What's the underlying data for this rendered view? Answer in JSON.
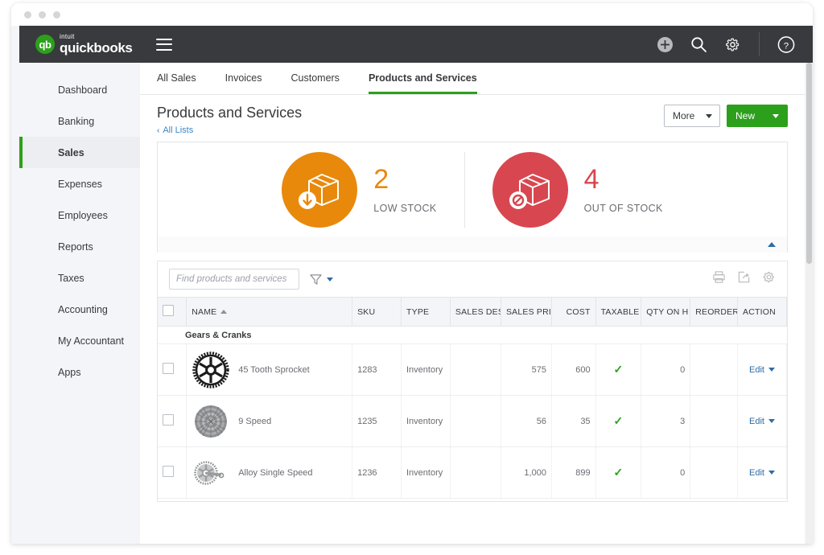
{
  "window": {
    "dots": [
      "dot-1",
      "dot-2",
      "dot-3"
    ]
  },
  "topbar": {
    "logo_intuit": "intuit",
    "logo_mark": "qb",
    "logo_name": "quickbooks",
    "menu_icon": "hamburger-menu-icon",
    "icons": [
      "add-circle-icon",
      "search-icon",
      "gear-icon",
      "help-circle-icon"
    ]
  },
  "sidebar": {
    "items": [
      {
        "label": "Dashboard",
        "active": false
      },
      {
        "label": "Banking",
        "active": false
      },
      {
        "label": "Sales",
        "active": true
      },
      {
        "label": "Expenses",
        "active": false
      },
      {
        "label": "Employees",
        "active": false
      },
      {
        "label": "Reports",
        "active": false
      },
      {
        "label": "Taxes",
        "active": false
      },
      {
        "label": "Accounting",
        "active": false
      },
      {
        "label": "My Accountant",
        "active": false
      },
      {
        "label": "Apps",
        "active": false
      }
    ]
  },
  "tabs": [
    {
      "label": "All Sales",
      "active": false
    },
    {
      "label": "Invoices",
      "active": false
    },
    {
      "label": "Customers",
      "active": false
    },
    {
      "label": "Products and Services",
      "active": true
    }
  ],
  "page": {
    "title": "Products and Services",
    "breadcrumb_chevron": "‹",
    "breadcrumb": "All Lists"
  },
  "actions": {
    "more_label": "More",
    "new_label": "New"
  },
  "stats": [
    {
      "value": "2",
      "label": "LOW STOCK",
      "color": "#e8890c",
      "icon": "box-down-arrow-icon"
    },
    {
      "value": "4",
      "label": "OUT OF STOCK",
      "color": "#d8474f",
      "icon": "box-prohibited-icon"
    }
  ],
  "collapse": {
    "icon": "chevron-up-icon"
  },
  "table_toolbar": {
    "search_placeholder": "Find products and services",
    "search_value": "",
    "filter_icon": "funnel-filter-icon",
    "print_icon": "printer-icon",
    "export_icon": "export-icon",
    "settings_icon": "gear-icon"
  },
  "table": {
    "columns": [
      {
        "key": "check",
        "label": ""
      },
      {
        "key": "name",
        "label": "NAME"
      },
      {
        "key": "sku",
        "label": "SKU"
      },
      {
        "key": "type",
        "label": "TYPE"
      },
      {
        "key": "sales_desc",
        "label": "SALES DES"
      },
      {
        "key": "sales_price",
        "label": "SALES PRIC"
      },
      {
        "key": "cost",
        "label": "COST"
      },
      {
        "key": "taxable",
        "label": "TAXABLE"
      },
      {
        "key": "qty_on_hand",
        "label": "QTY ON H"
      },
      {
        "key": "reorder",
        "label": "REORDER"
      },
      {
        "key": "action",
        "label": "ACTION"
      }
    ],
    "sort_column": "NAME",
    "sort_direction": "asc",
    "group_label": "Gears & Cranks",
    "action_label": "Edit",
    "taxable_mark": "✓",
    "rows": [
      {
        "name": "45 Tooth Sprocket",
        "sku": "1283",
        "type": "Inventory",
        "sales_desc": "",
        "sales_price": "575",
        "cost": "600",
        "taxable": true,
        "qty_on_hand": "0",
        "reorder": "",
        "action": "Edit",
        "thumb": "sprocket-thumbnail"
      },
      {
        "name": "9 Speed",
        "sku": "1235",
        "type": "Inventory",
        "sales_desc": "",
        "sales_price": "56",
        "cost": "35",
        "taxable": true,
        "qty_on_hand": "3",
        "reorder": "",
        "action": "Edit",
        "thumb": "cassette-thumbnail"
      },
      {
        "name": "Alloy Single Speed",
        "sku": "1236",
        "type": "Inventory",
        "sales_desc": "",
        "sales_price": "1,000",
        "cost": "899",
        "taxable": true,
        "qty_on_hand": "0",
        "reorder": "",
        "action": "Edit",
        "thumb": "crankset-thumbnail"
      }
    ]
  }
}
